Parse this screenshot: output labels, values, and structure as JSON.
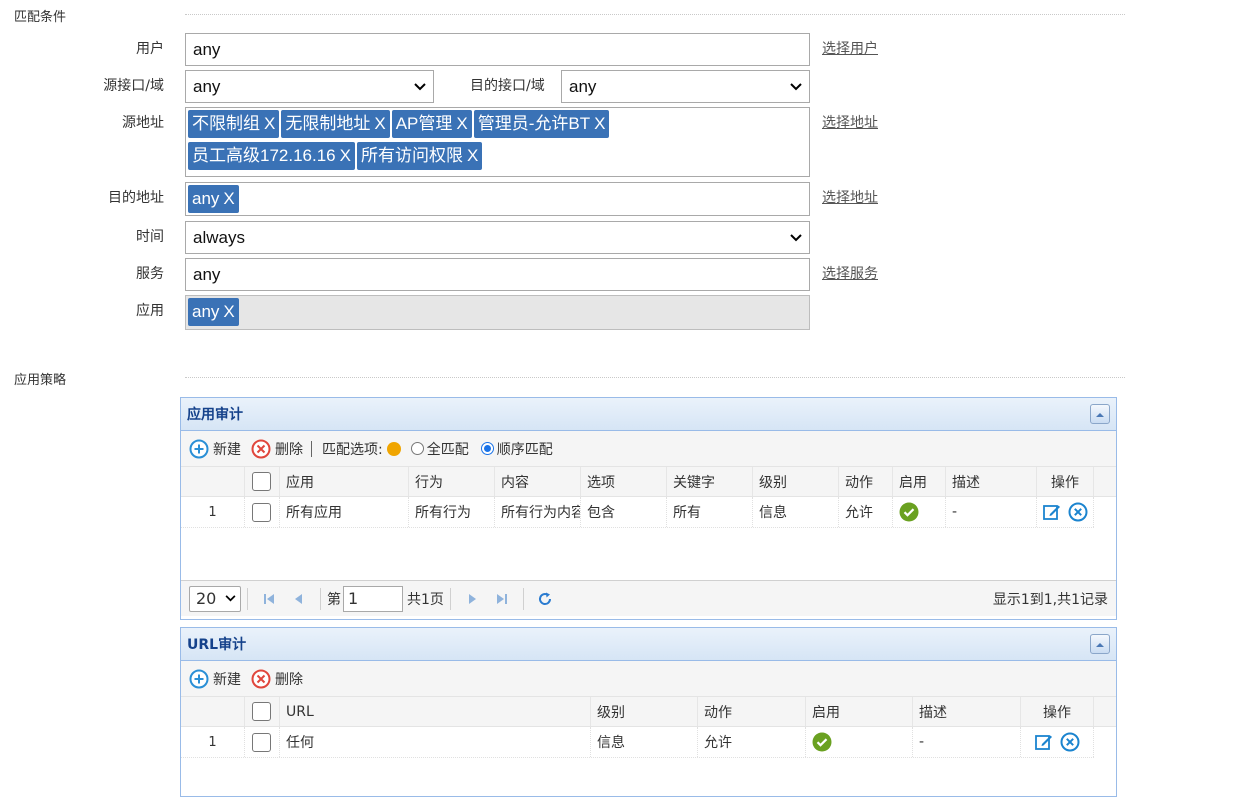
{
  "match_section": {
    "title": "匹配条件",
    "user": {
      "label": "用户",
      "value": "any",
      "link": "选择用户"
    },
    "src_iface": {
      "label": "源接口/域",
      "value": "any"
    },
    "dst_iface": {
      "label": "目的接口/域",
      "value": "any"
    },
    "src_addr": {
      "label": "源地址",
      "link": "选择地址",
      "tags": [
        "不限制组",
        "无限制地址",
        "AP管理",
        "管理员-允许BT",
        "员工高级172.16.16",
        "所有访问权限"
      ]
    },
    "dst_addr": {
      "label": "目的地址",
      "link": "选择地址",
      "tags": [
        "any"
      ]
    },
    "time": {
      "label": "时间",
      "value": "always"
    },
    "service": {
      "label": "服务",
      "value": "any",
      "link": "选择服务"
    },
    "app": {
      "label": "应用",
      "tags": [
        "any"
      ]
    },
    "tag_close": "X"
  },
  "policy_section": {
    "title": "应用策略"
  },
  "app_audit": {
    "title": "应用审计",
    "toolbar": {
      "new": "新建",
      "delete": "删除",
      "match_option": "匹配选项:",
      "opt_all": "全匹配",
      "opt_order": "顺序匹配",
      "selected": "顺序匹配"
    },
    "columns": [
      "应用",
      "行为",
      "内容",
      "选项",
      "关键字",
      "级别",
      "动作",
      "启用",
      "描述",
      "操作"
    ],
    "rows": [
      {
        "num": "1",
        "app": "所有应用",
        "behavior": "所有行为",
        "content": "所有行为内容",
        "option": "包含",
        "keyword": "所有",
        "level": "信息",
        "action": "允许",
        "enabled": true,
        "desc": "-"
      }
    ],
    "pager": {
      "page_size": "20",
      "page_prefix": "第",
      "page": "1",
      "page_total": "共1页",
      "summary": "显示1到1,共1记录"
    }
  },
  "url_audit": {
    "title": "URL审计",
    "toolbar": {
      "new": "新建",
      "delete": "删除"
    },
    "columns": [
      "URL",
      "级别",
      "动作",
      "启用",
      "描述",
      "操作"
    ],
    "rows": [
      {
        "num": "1",
        "url": "任何",
        "level": "信息",
        "action": "允许",
        "enabled": true,
        "desc": "-"
      }
    ]
  },
  "colors": {
    "tag": "#3a72b6",
    "panel_border": "#99bbe8",
    "panel_title": "#15428b",
    "ok": "#6aa121",
    "new_icon": "#2a8fd6",
    "delete_icon": "#e0463c"
  }
}
